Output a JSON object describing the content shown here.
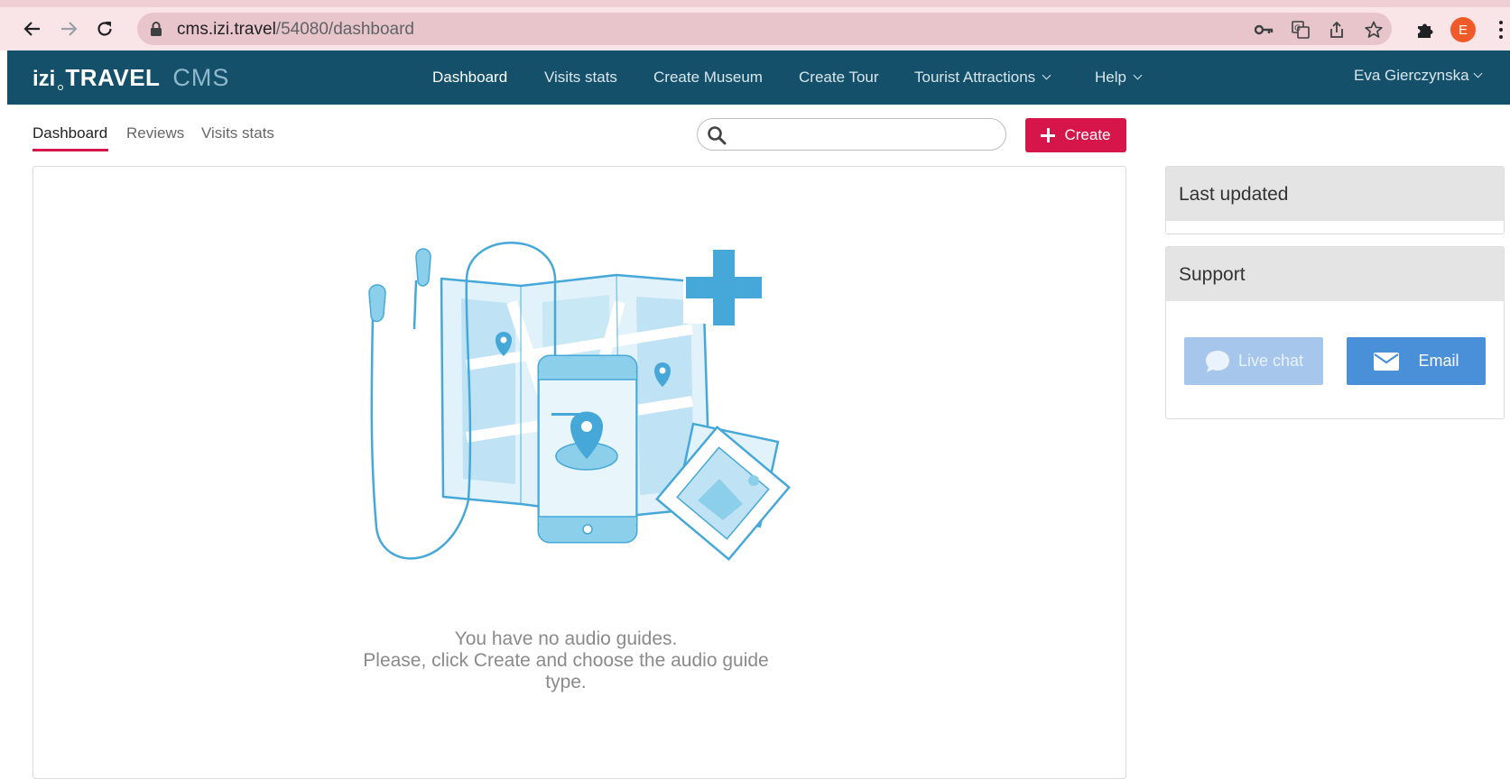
{
  "browser": {
    "url_host": "cms.izi.travel",
    "url_path": "/54080/dashboard",
    "profile_initial": "E",
    "icons": [
      "back-arrow-icon",
      "forward-arrow-icon",
      "reload-icon",
      "lock-icon",
      "key-icon",
      "translate-icon",
      "share-icon",
      "star-icon",
      "puzzle-icon",
      "kebab-icon"
    ]
  },
  "header": {
    "logo_izi": "izi",
    "logo_travel": "TRAVEL",
    "logo_cms": "CMS",
    "nav": [
      {
        "label": "Dashboard",
        "active": true
      },
      {
        "label": "Visits stats"
      },
      {
        "label": "Create Museum"
      },
      {
        "label": "Create Tour"
      },
      {
        "label": "Tourist Attractions",
        "dropdown": true
      },
      {
        "label": "Help",
        "dropdown": true
      }
    ],
    "user": "Eva Gierczynska"
  },
  "subtabs": [
    {
      "label": "Dashboard",
      "active": true
    },
    {
      "label": "Reviews"
    },
    {
      "label": "Visits stats"
    }
  ],
  "search": {
    "placeholder": "",
    "value": ""
  },
  "create_label": "Create",
  "empty_state": {
    "line1": "You have no audio guides.",
    "line2": "Please, click Create and choose the audio guide",
    "line3": "type."
  },
  "sidebar": {
    "last_updated_title": "Last updated",
    "support_title": "Support",
    "live_chat_label": "Live chat",
    "email_label": "Email"
  },
  "colors": {
    "header_bg": "#14506a",
    "accent": "#d6164a",
    "email_button": "#4a90d9",
    "live_chat_button": "#a6c6ec",
    "illustration": "#45a8d8"
  }
}
